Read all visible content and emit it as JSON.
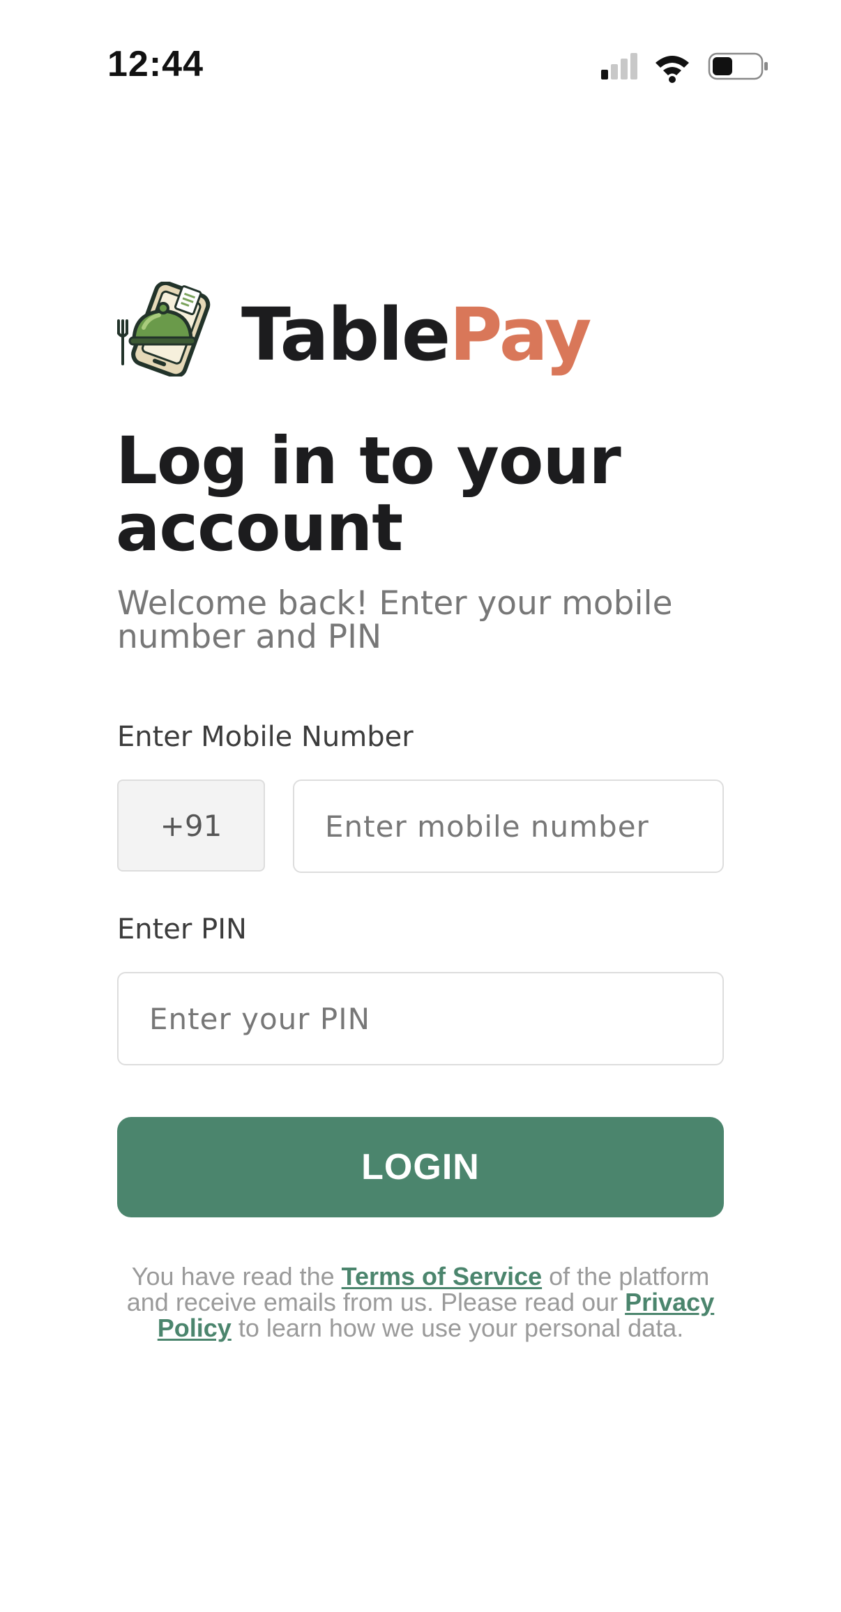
{
  "status_bar": {
    "time": "12:44"
  },
  "brand": {
    "name_part1": "Table",
    "name_part2": "Pay",
    "color_dark": "#1c1c1e",
    "color_accent": "#d97759",
    "logo_icon": "serving-cloche-phone-icon"
  },
  "login": {
    "title": "Log in to your account",
    "subtitle": "Welcome back! Enter your mobile number and PIN",
    "mobile_label": "Enter Mobile Number",
    "country_code": "+91",
    "mobile_value": "",
    "mobile_placeholder": "Enter mobile number",
    "pin_label": "Enter PIN",
    "pin_value": "",
    "pin_placeholder": "Enter your PIN",
    "button_label": "LOGIN",
    "button_color": "#4b856d"
  },
  "legal": {
    "text_1": "You have read the ",
    "terms_link": "Terms of Service",
    "text_2": " of the platform and receive emails from us. Please read our ",
    "privacy_link": "Privacy Policy",
    "text_3": " to learn how we use your personal data."
  }
}
